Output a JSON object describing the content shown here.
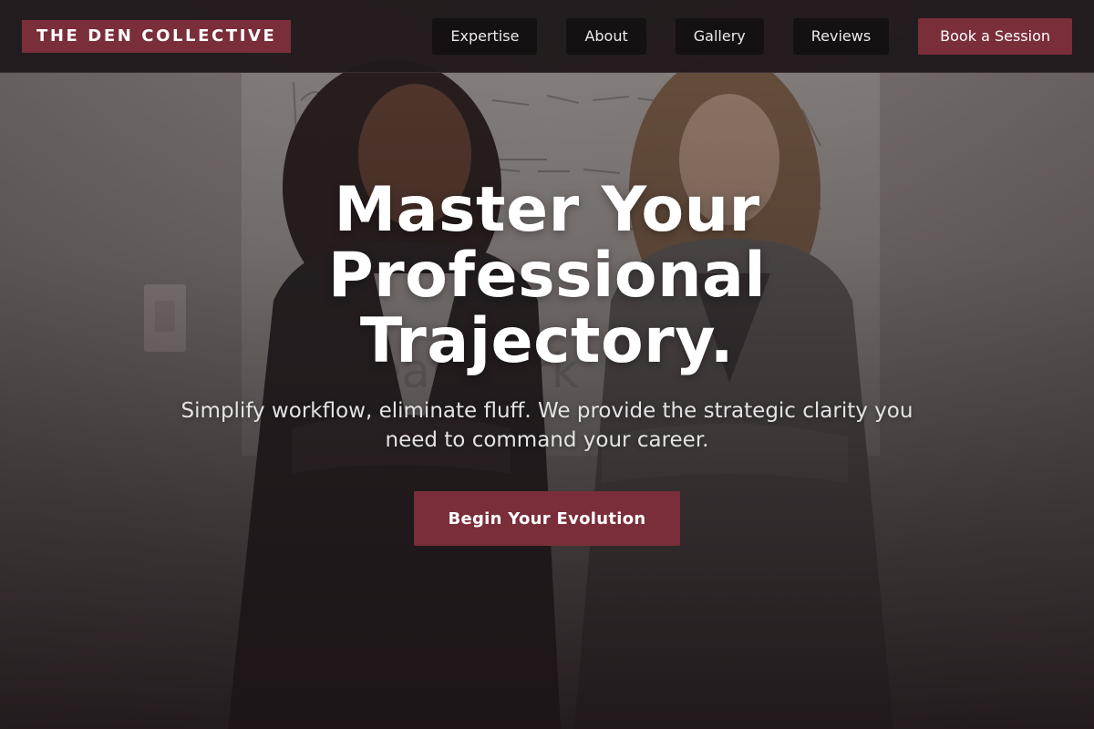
{
  "header": {
    "brand": "THE DEN COLLECTIVE",
    "nav": [
      {
        "label": "Expertise"
      },
      {
        "label": "About"
      },
      {
        "label": "Gallery"
      },
      {
        "label": "Reviews"
      }
    ],
    "cta_label": "Book a Session"
  },
  "hero": {
    "title_lines": [
      "Master Your",
      "Professional",
      "Trajectory."
    ],
    "subtitle": "Simplify workflow, eliminate fluff. We provide the strategic clarity you need to command your career.",
    "cta_label": "Begin Your Evolution"
  },
  "colors": {
    "accent": "#7a2e3a",
    "header_bg": "#211a1c",
    "nav_button_bg": "#151012",
    "text_primary": "#ffffff"
  }
}
